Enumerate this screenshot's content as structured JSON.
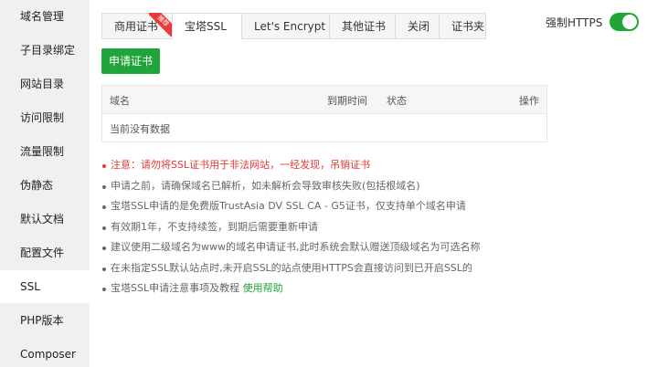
{
  "sidebar": {
    "items": [
      {
        "label": "域名管理"
      },
      {
        "label": "子目录绑定"
      },
      {
        "label": "网站目录"
      },
      {
        "label": "访问限制"
      },
      {
        "label": "流量限制"
      },
      {
        "label": "伪静态"
      },
      {
        "label": "默认文档"
      },
      {
        "label": "配置文件"
      },
      {
        "label": "SSL",
        "active": true
      },
      {
        "label": "PHP版本"
      },
      {
        "label": "Composer"
      }
    ]
  },
  "tabs": [
    {
      "label": "商用证书",
      "badge": "推荐"
    },
    {
      "label": "宝塔SSL",
      "active": true
    },
    {
      "label": "Let's Encrypt"
    },
    {
      "label": "其他证书"
    },
    {
      "label": "关闭"
    },
    {
      "label": "证书夹"
    }
  ],
  "force_https": {
    "label": "强制HTTPS",
    "enabled": true
  },
  "apply_button": "申请证书",
  "table": {
    "columns": [
      "域名",
      "到期时间",
      "状态",
      "操作"
    ],
    "empty_text": "当前没有数据"
  },
  "notes": [
    "注意：请勿将SSL证书用于非法网站，一经发现，吊销证书",
    "申请之前，请确保域名已解析，如未解析会导致审核失败(包括根域名)",
    "宝塔SSL申请的是免费版TrustAsia DV SSL CA - G5证书，仅支持单个域名申请",
    "有效期1年，不支持续签，到期后需要重新申请",
    "建议使用二级域名为www的域名申请证书,此时系统会默认赠送顶级域名为可选名称",
    "在未指定SSL默认站点时,未开启SSL的站点使用HTTPS会直接访问到已开启SSL的"
  ],
  "help": {
    "text": "宝塔SSL申请注意事项及教程",
    "link": "使用帮助"
  },
  "colors": {
    "accent": "#20a53a",
    "warning": "#e53935",
    "badge": "#e83c3c",
    "sidebar_bg": "#f0f0f0"
  }
}
